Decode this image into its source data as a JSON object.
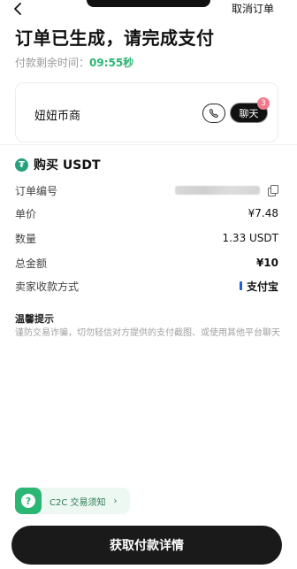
{
  "header": {
    "cancel_label": "取消订单"
  },
  "title": "订单已生成，请完成支付",
  "countdown": {
    "label": "付款剩余时间：",
    "time": "09:55秒"
  },
  "merchant": {
    "name": "妞妞币商",
    "chat_label": "聊天",
    "unread_count": "3"
  },
  "product": {
    "icon_glyph": "₮",
    "title": "购买 USDT"
  },
  "details": {
    "order_no_label": "订单编号",
    "unit_price_label": "单价",
    "unit_price": "¥7.48",
    "quantity_label": "数量",
    "quantity": "1.33 USDT",
    "total_label": "总金额",
    "total": "¥10",
    "payment_method_label": "卖家收款方式",
    "payment_method": "支付宝"
  },
  "tips": {
    "title": "温馨提示",
    "body": "谨防交易诈骗，切勿轻信对方提供的支付截图、或使用其他平台聊天"
  },
  "c2c_link": {
    "icon_glyph": "?",
    "label": "C2C 交易须知",
    "chevron": "›"
  },
  "main_button": {
    "label": "获取付款详情"
  },
  "colors": {
    "accent_green": "#2bb673",
    "usdt_green": "#26a17b",
    "badge_pink": "#f07a8c",
    "alipay_blue": "#1f5fd6",
    "button_dark": "#1a1a1a"
  }
}
